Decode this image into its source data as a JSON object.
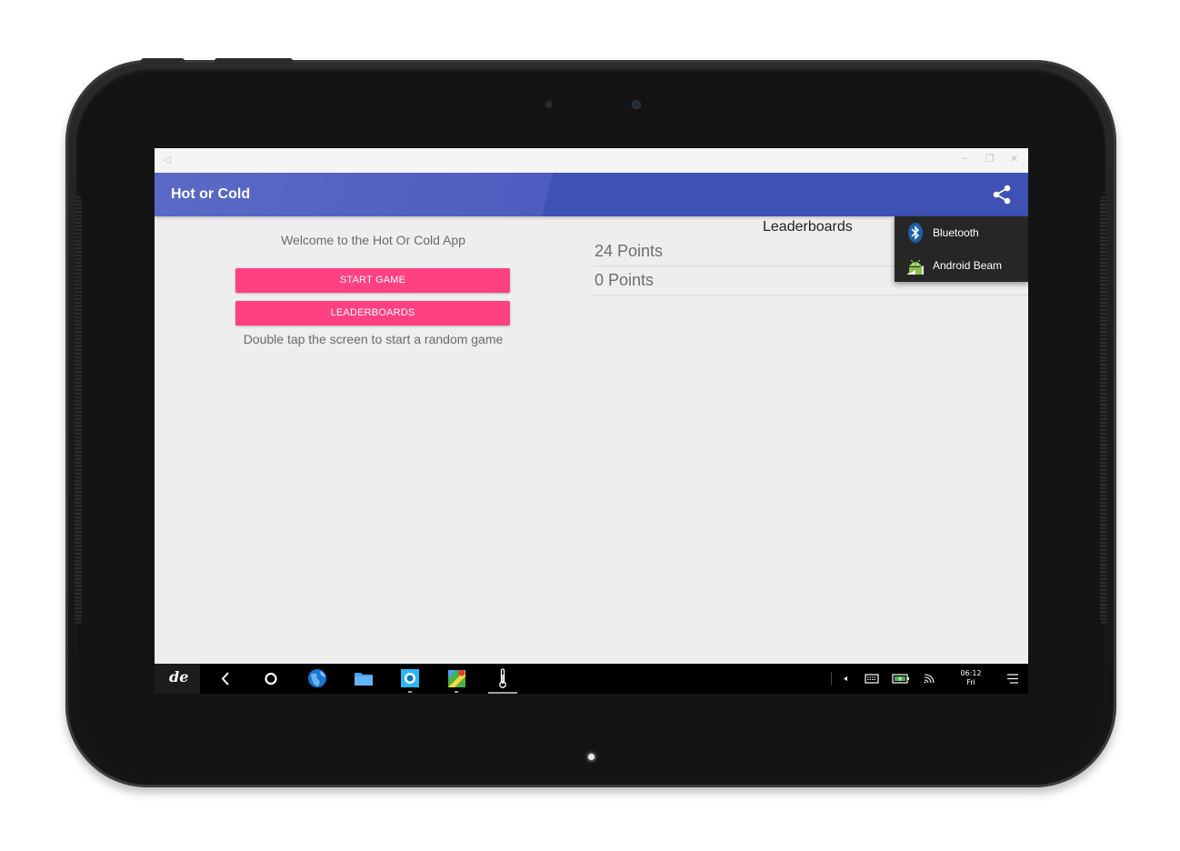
{
  "app": {
    "title": "Hot or Cold"
  },
  "main": {
    "welcome_text": "Welcome to the Hot Or Cold App",
    "start_button": "START GAME",
    "leaderboards_button": "LEADERBOARDS",
    "hint_text": "Double tap the screen to start a random game"
  },
  "leaderboard": {
    "title": "Leaderboards",
    "scores": [
      "24 Points",
      "0 Points"
    ]
  },
  "share_menu": {
    "items": [
      {
        "label": "Bluetooth",
        "icon": "bluetooth-icon"
      },
      {
        "label": "Android Beam",
        "icon": "android-icon"
      }
    ]
  },
  "taskbar": {
    "time": "06:12",
    "day": "Fri",
    "apps": [
      "globe-icon",
      "folder-icon",
      "camera-icon",
      "maps-icon",
      "thermometer-icon"
    ]
  },
  "colors": {
    "primary": "#3f51b5",
    "accent": "#ff4081",
    "background": "#eeeeee"
  }
}
